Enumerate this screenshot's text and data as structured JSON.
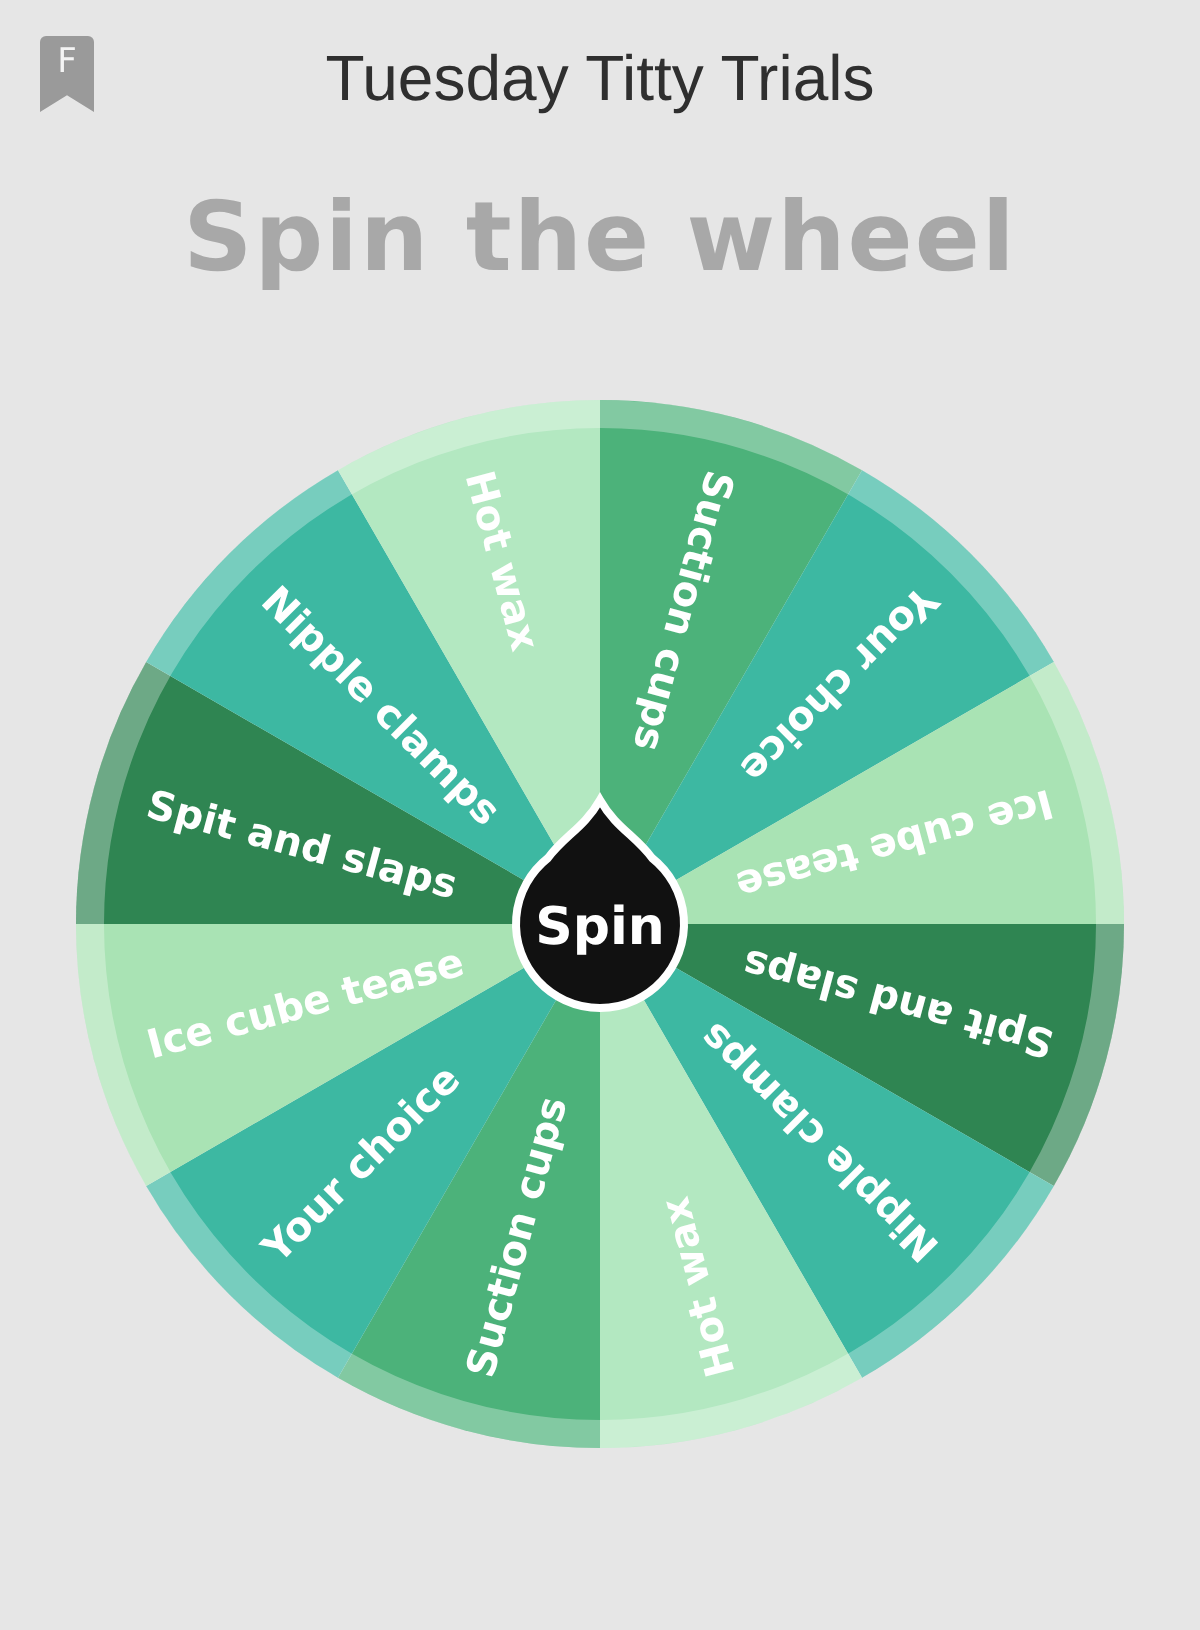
{
  "badge": "F",
  "app_title": "Tuesday Titty Trials",
  "heading": "Spin the wheel",
  "wheel": {
    "spin_button": "Spin",
    "segments": [
      {
        "label": "Suction cups",
        "color": "#4cb27a"
      },
      {
        "label": "Your choice",
        "color": "#3db8a2"
      },
      {
        "label": "Ice cube tease",
        "color": "#a9e3b4"
      },
      {
        "label": "Spit and slaps",
        "color": "#2f8552"
      },
      {
        "label": "Nipple clamps",
        "color": "#3db8a2"
      },
      {
        "label": "Hot wax",
        "color": "#b3e8c1"
      },
      {
        "label": "Suction cups",
        "color": "#4cb27a"
      },
      {
        "label": "Your choice",
        "color": "#3db8a2"
      },
      {
        "label": "Ice cube tease",
        "color": "#a9e3b4"
      },
      {
        "label": "Spit and slaps",
        "color": "#2f8552"
      },
      {
        "label": "Nipple clamps",
        "color": "#3db8a2"
      },
      {
        "label": "Hot wax",
        "color": "#b3e8c1"
      }
    ]
  }
}
